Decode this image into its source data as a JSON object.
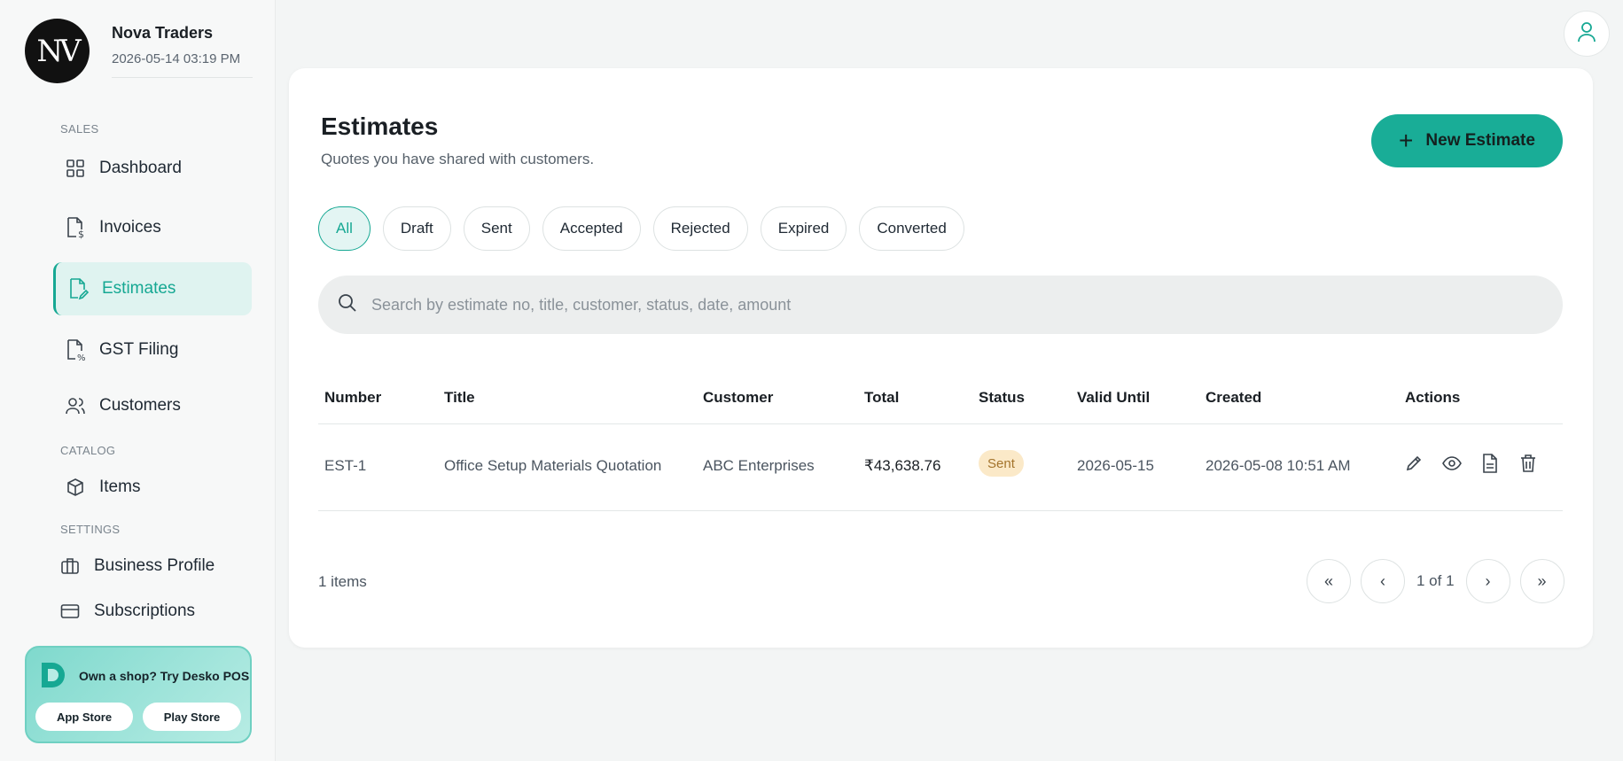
{
  "brand": {
    "logo_text": "NV",
    "name": "Nova Traders",
    "datetime": "2026-05-14 03:19 PM"
  },
  "sidebar": {
    "sections": {
      "sales": "SALES",
      "catalog": "CATALOG",
      "settings": "SETTINGS"
    },
    "items": {
      "dashboard": "Dashboard",
      "invoices": "Invoices",
      "estimates": "Estimates",
      "gst": "GST Filing",
      "customers": "Customers",
      "items": "Items",
      "business_profile": "Business Profile",
      "subscriptions": "Subscriptions"
    },
    "active": "Estimates"
  },
  "promo": {
    "text": "Own a shop? Try Desko POS",
    "app_store": "App Store",
    "play_store": "Play Store"
  },
  "page": {
    "title": "Estimates",
    "subtitle": "Quotes you have shared with customers.",
    "new_button": "New Estimate"
  },
  "filters": [
    "All",
    "Draft",
    "Sent",
    "Accepted",
    "Rejected",
    "Expired",
    "Converted"
  ],
  "active_filter": "All",
  "search": {
    "placeholder": "Search by estimate no, title, customer, status, date, amount",
    "value": ""
  },
  "table": {
    "headers": {
      "number": "Number",
      "title": "Title",
      "customer": "Customer",
      "total": "Total",
      "status": "Status",
      "valid_until": "Valid Until",
      "created": "Created",
      "actions": "Actions"
    },
    "rows": [
      {
        "number": "EST-1",
        "title": "Office Setup Materials Quotation",
        "customer": "ABC Enterprises",
        "total": "₹43,638.76",
        "status": "Sent",
        "valid_until": "2026-05-15",
        "created": "2026-05-08 10:51 AM"
      }
    ]
  },
  "footer": {
    "items_count": "1 items",
    "page_info": "1 of 1"
  },
  "colors": {
    "accent": "#19ad97",
    "sent_badge_bg": "#fbe9c8",
    "sent_badge_text": "#a4742c"
  }
}
